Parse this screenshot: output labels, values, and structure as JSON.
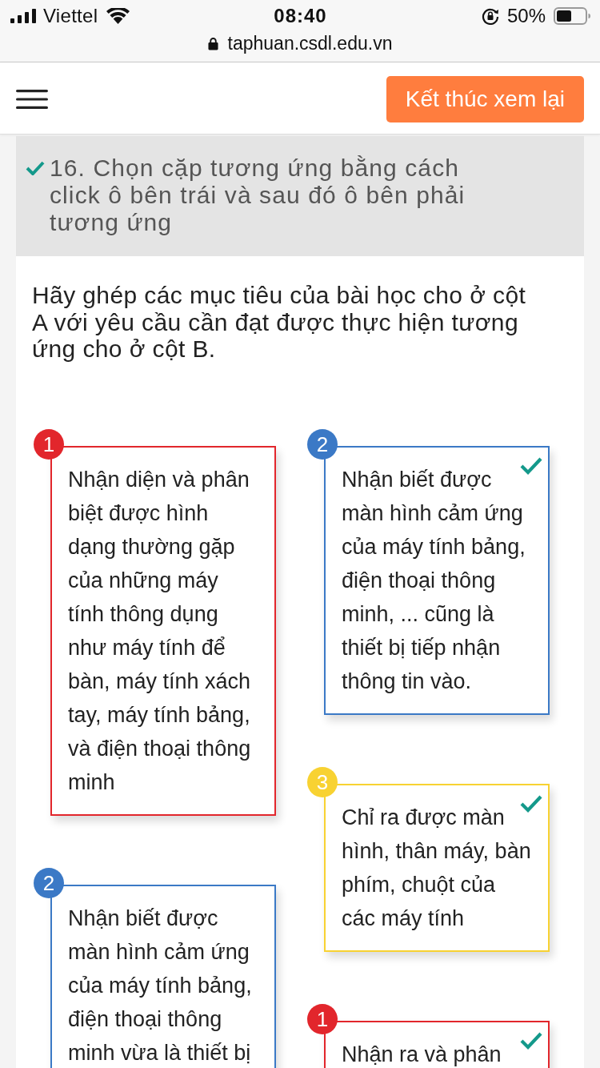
{
  "status_bar": {
    "carrier": "Viettel",
    "time": "08:40",
    "battery": "50%"
  },
  "address_bar": {
    "url": "taphuan.csdl.edu.vn"
  },
  "header": {
    "button": "Kết thúc xem lại"
  },
  "question": {
    "title": "16. Chọn cặp tương ứng bằng cách click ô bên trái và sau đó ô bên phải tương ứng",
    "correct": true,
    "prompt": "Hãy ghép các mục tiêu của bài học cho ở cột A với yêu cầu cần đạt được thực hiện tương ứng cho ở cột B."
  },
  "column_a": [
    {
      "number": "1",
      "color": "#e2262c",
      "text": "Nhận diện và phân biệt được hình dạng thường gặp của những máy tính thông dụng như máy tính để bàn, máy tính xách tay, máy tính bảng, và điện thoại thông minh"
    },
    {
      "number": "2",
      "color": "#3b79c6",
      "text": "Nhận biết được màn hình cảm ứng của máy tính bảng, điện thoại thông minh vừa là thiết bị"
    }
  ],
  "column_b": [
    {
      "number": "2",
      "color": "#3b79c6",
      "text": "Nhận biết được màn hình cảm ứng của máy tính bảng, điện thoại thông minh, ... cũng là thiết bị tiếp nhận thông tin vào.",
      "correct": true
    },
    {
      "number": "3",
      "color": "#f8d232",
      "text": "Chỉ ra được màn hình, thân máy, bàn phím, chuột của các máy tính",
      "correct": true
    },
    {
      "number": "1",
      "color": "#e2262c",
      "text": "Nhận ra và phân",
      "correct": true
    }
  ]
}
